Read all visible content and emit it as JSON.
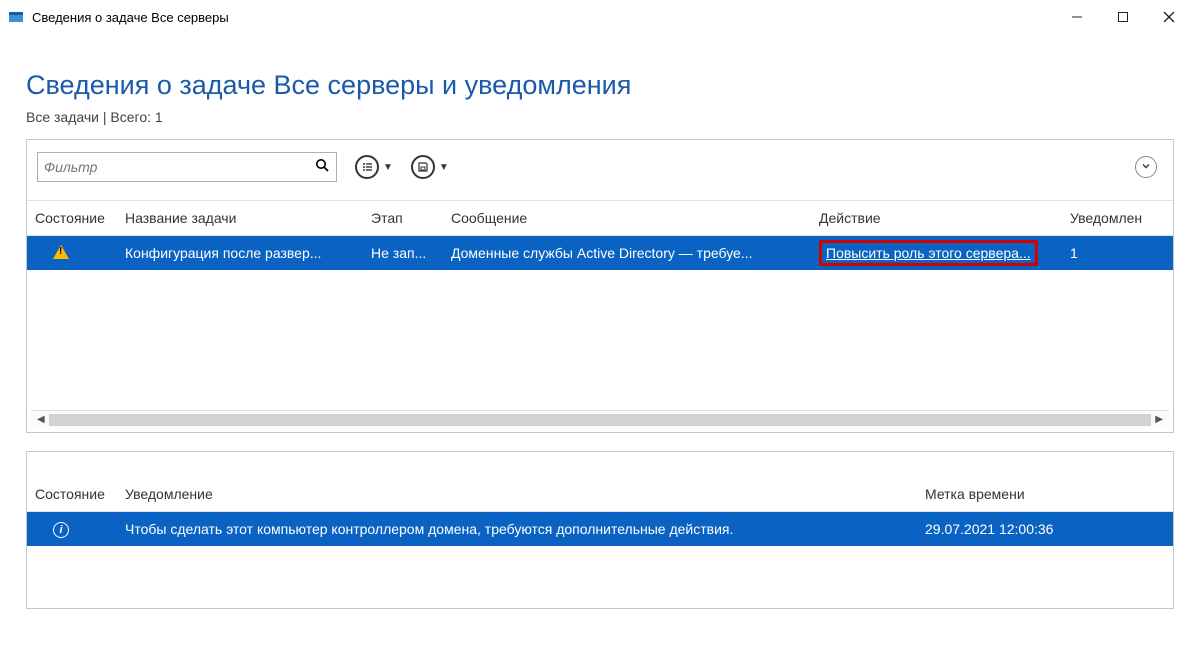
{
  "window": {
    "title": "Сведения о задаче Все серверы"
  },
  "page": {
    "heading": "Сведения о задаче Все серверы и уведомления",
    "subtitle": "Все задачи | Всего: 1"
  },
  "filter": {
    "placeholder": "Фильтр"
  },
  "tasks": {
    "headers": {
      "state": "Состояние",
      "task": "Название задачи",
      "stage": "Этап",
      "message": "Сообщение",
      "action": "Действие",
      "notifications": "Уведомлен"
    },
    "row": {
      "task": "Конфигурация после развер...",
      "stage": "Не зап...",
      "message": "Доменные службы Active Directory — требуе...",
      "action": "Повысить роль этого сервера...",
      "notifications": "1"
    }
  },
  "notifications": {
    "headers": {
      "state": "Состояние",
      "notification": "Уведомление",
      "timestamp": "Метка времени"
    },
    "row": {
      "text": "Чтобы сделать этот компьютер контроллером домена, требуются дополнительные действия.",
      "timestamp": "29.07.2021 12:00:36"
    }
  }
}
